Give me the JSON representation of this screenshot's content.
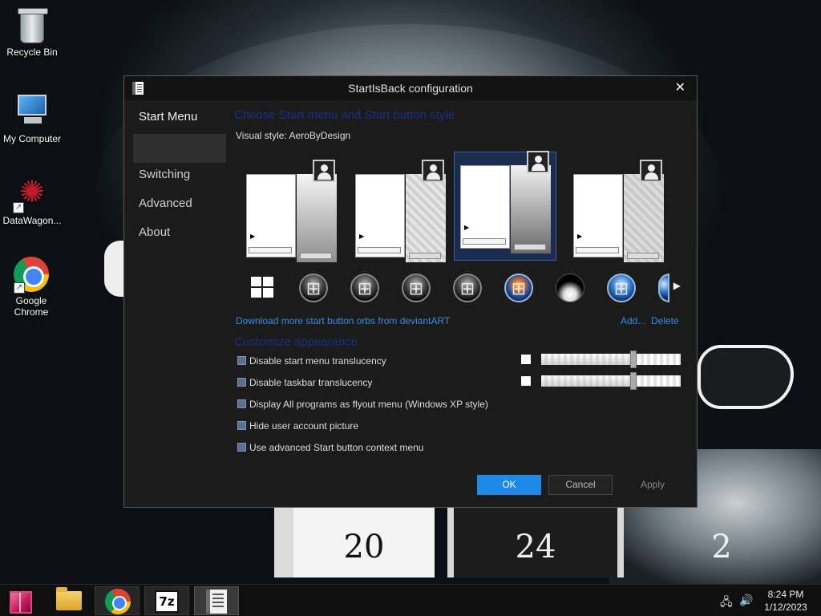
{
  "desktop": {
    "icons": [
      {
        "label": "Recycle Bin",
        "icon": "recycle-bin-icon"
      },
      {
        "label": "My Computer",
        "icon": "computer-icon"
      },
      {
        "label": "DataWagon...",
        "icon": "datawagon-icon"
      },
      {
        "label": "Google Chrome",
        "icon": "chrome-icon"
      }
    ],
    "tiles": [
      "20",
      "24",
      "2"
    ]
  },
  "dialog": {
    "title": "StartIsBack configuration",
    "close_glyph": "✕",
    "nav": [
      "Start Menu",
      "Switching",
      "Advanced",
      "About"
    ],
    "style_heading": "Choose Start menu and Start button style",
    "visual_style_label": "Visual style:",
    "visual_style_value": "AeroByDesign",
    "start_menu_styles": [
      "style-1",
      "style-2",
      "style-3",
      "style-4"
    ],
    "selected_style_index": 2,
    "orbs": [
      "windows-8",
      "windows-7-dark",
      "windows-flag-dark-1",
      "windows-flag-dark-2",
      "windows-flag-dark-3",
      "windows-vista-orb",
      "eclipse-orb",
      "windows-7-blue",
      "partial-orb"
    ],
    "orbs_next_glyph": "▶",
    "download_link": "Download more start button orbs from deviantART",
    "add_link": "Add...",
    "delete_link": "Delete",
    "appearance_heading": "Customize appearance",
    "options": [
      "Disable start menu translucency",
      "Disable taskbar translucency",
      "Display All programs as flyout menu (Windows XP style)",
      "Hide user account picture",
      "Use advanced Start button context menu"
    ],
    "sliders": [
      {
        "name": "start-menu-translucency",
        "value_percent": 66
      },
      {
        "name": "taskbar-translucency",
        "value_percent": 66
      }
    ],
    "buttons": {
      "ok": "OK",
      "cancel": "Cancel",
      "apply": "Apply"
    },
    "accent_color": "#1e8ae8",
    "heading_color": "#1c2f85"
  },
  "taskbar": {
    "items": [
      "start-button",
      "file-explorer",
      "google-chrome",
      "7-zip",
      "startisback-config"
    ],
    "active_item": "startisback-config",
    "tray": {
      "network_icon": "network-icon",
      "volume_icon": "volume-icon"
    },
    "time": "8:24 PM",
    "date": "1/12/2023"
  }
}
